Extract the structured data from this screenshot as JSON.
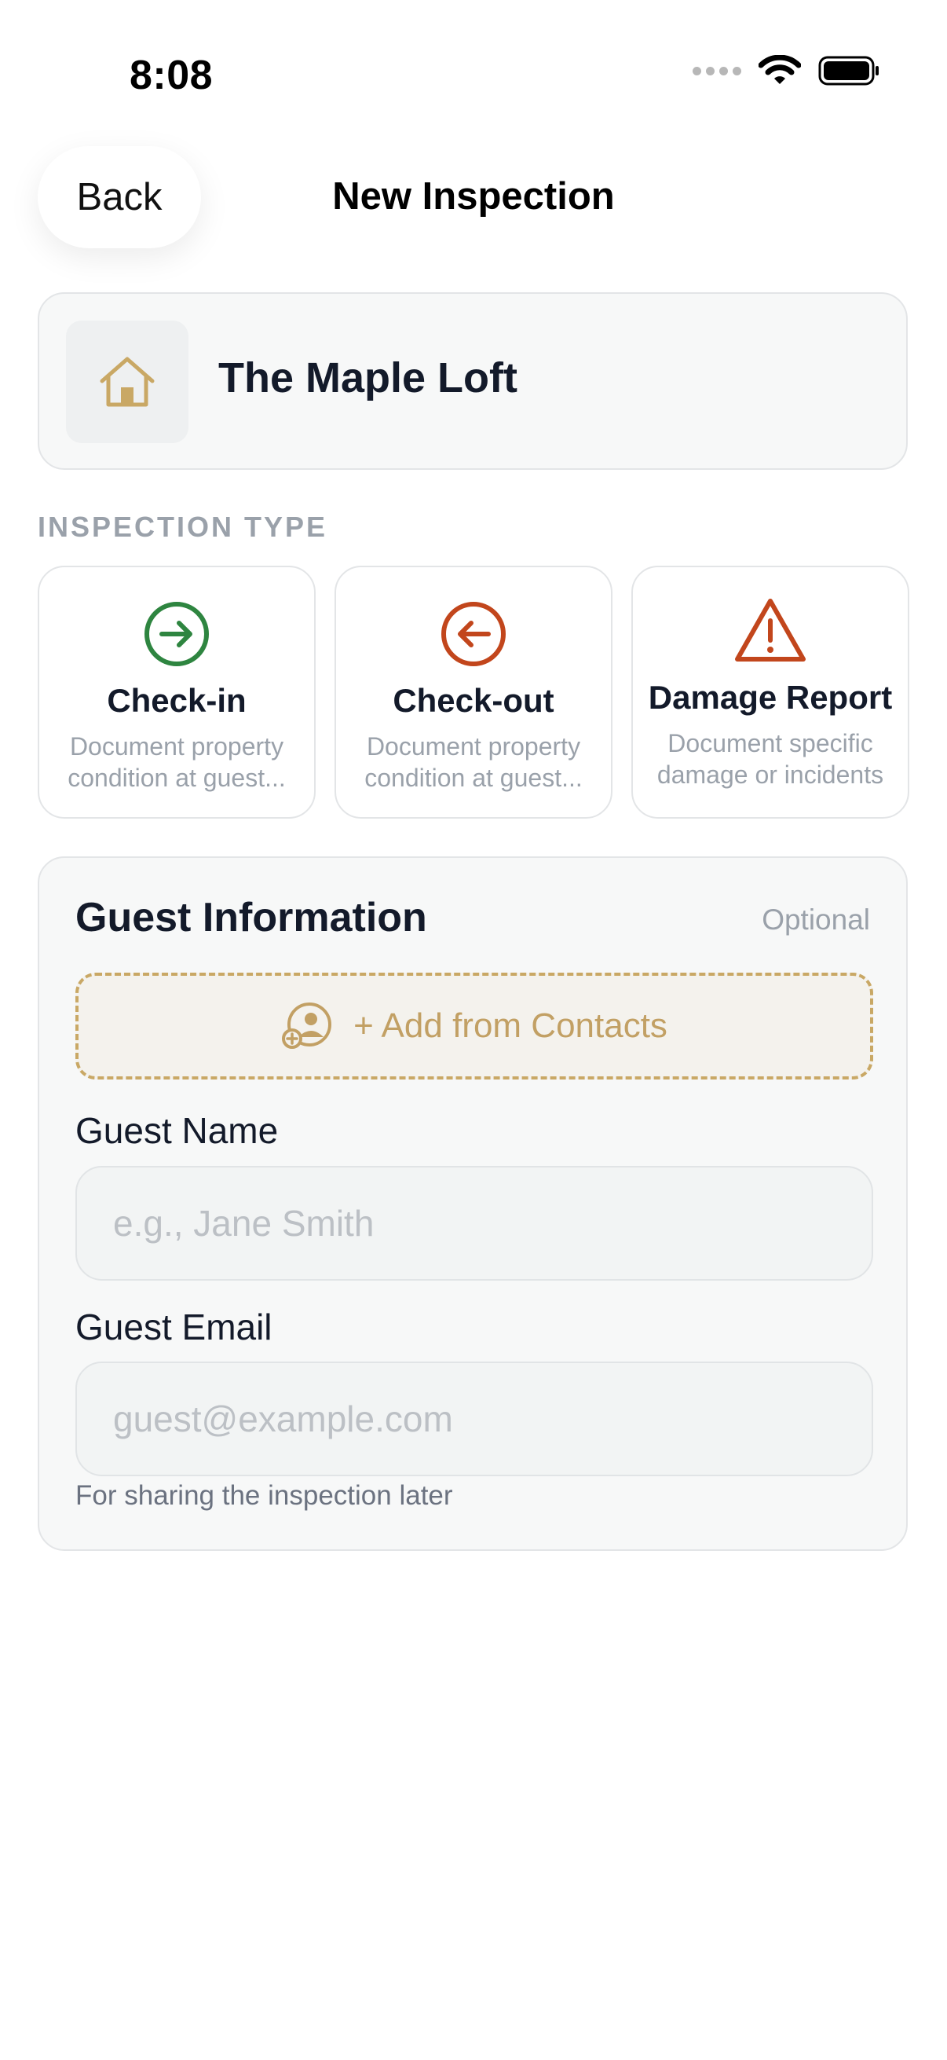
{
  "status_bar": {
    "time": "8:08"
  },
  "nav": {
    "back_label": "Back",
    "title": "New Inspection"
  },
  "property": {
    "name": "The Maple Loft",
    "icon": "house-icon"
  },
  "inspection_type": {
    "section_label": "INSPECTION TYPE",
    "options": [
      {
        "title": "Check-in",
        "desc_line1": "Document property",
        "desc_line2": "condition at guest...",
        "icon": "arrow-right-circle-icon",
        "color": "#2e8540"
      },
      {
        "title": "Check-out",
        "desc_line1": "Document property",
        "desc_line2": "condition at guest...",
        "icon": "arrow-left-circle-icon",
        "color": "#c2461c"
      },
      {
        "title": "Damage Report",
        "desc_line1": "Document specific",
        "desc_line2": "damage or incidents",
        "icon": "warning-triangle-icon",
        "color": "#c2461c"
      }
    ]
  },
  "guest": {
    "title": "Guest Information",
    "optional_label": "Optional",
    "add_contacts_label": "+ Add from Contacts",
    "name_label": "Guest Name",
    "name_value": "",
    "name_placeholder": "e.g., Jane Smith",
    "email_label": "Guest Email",
    "email_value": "",
    "email_placeholder": "guest@example.com",
    "helper_text": "For sharing the inspection later"
  },
  "colors": {
    "accent_gold": "#c9a865",
    "text_dark": "#131a2a",
    "muted": "#9aa1aa"
  }
}
